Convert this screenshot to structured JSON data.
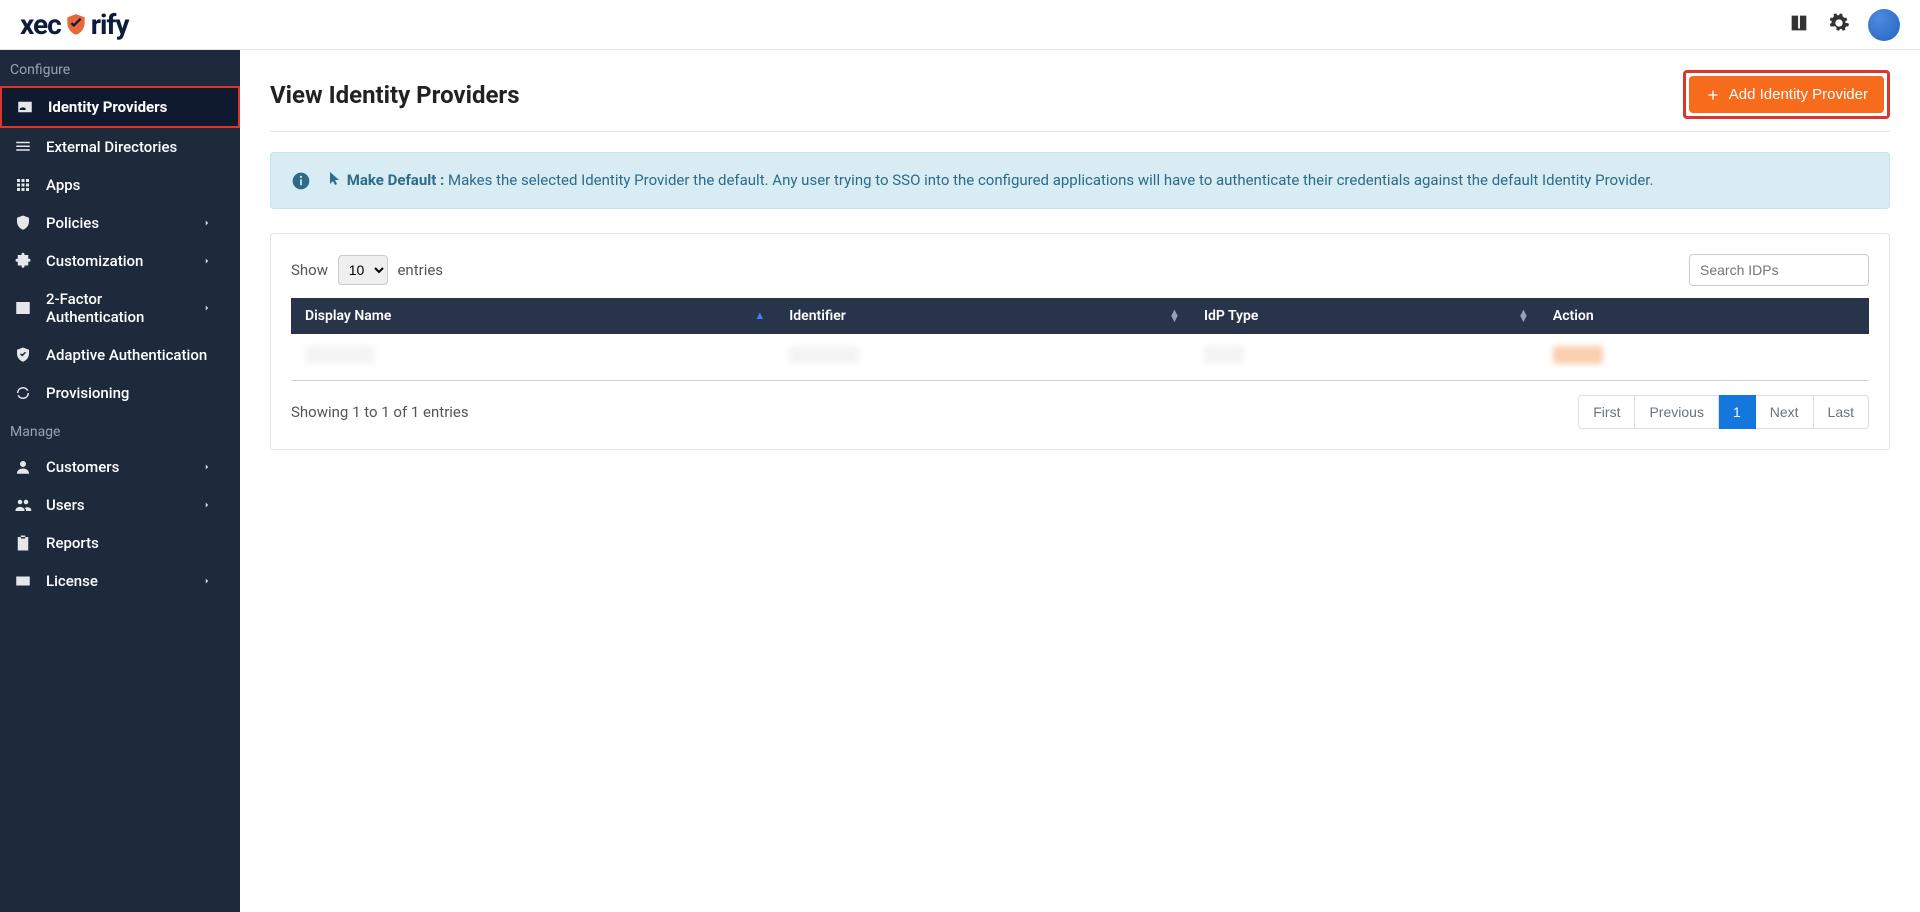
{
  "brand": {
    "pre": "xec",
    "post": "rify"
  },
  "sidebar": {
    "sections": [
      {
        "label": "Configure",
        "items": [
          {
            "label": "Identity Providers",
            "icon": "id-card-icon",
            "active": true,
            "highlighted": true,
            "chevron": false
          },
          {
            "label": "External Directories",
            "icon": "list-icon",
            "active": false,
            "highlighted": false,
            "chevron": false
          },
          {
            "label": "Apps",
            "icon": "grid-icon",
            "active": false,
            "highlighted": false,
            "chevron": false
          },
          {
            "label": "Policies",
            "icon": "shield-icon",
            "active": false,
            "highlighted": false,
            "chevron": true
          },
          {
            "label": "Customization",
            "icon": "puzzle-icon",
            "active": false,
            "highlighted": false,
            "chevron": true
          },
          {
            "label": "2-Factor Authentication",
            "icon": "keypad-icon",
            "active": false,
            "highlighted": false,
            "chevron": true
          },
          {
            "label": "Adaptive Authentication",
            "icon": "shield-check-icon",
            "active": false,
            "highlighted": false,
            "chevron": false
          },
          {
            "label": "Provisioning",
            "icon": "sync-icon",
            "active": false,
            "highlighted": false,
            "chevron": false
          }
        ]
      },
      {
        "label": "Manage",
        "items": [
          {
            "label": "Customers",
            "icon": "person-icon",
            "active": false,
            "highlighted": false,
            "chevron": true
          },
          {
            "label": "Users",
            "icon": "people-icon",
            "active": false,
            "highlighted": false,
            "chevron": true
          },
          {
            "label": "Reports",
            "icon": "clipboard-icon",
            "active": false,
            "highlighted": false,
            "chevron": false
          },
          {
            "label": "License",
            "icon": "card-icon",
            "active": false,
            "highlighted": false,
            "chevron": true
          }
        ]
      }
    ]
  },
  "page": {
    "title": "View Identity Providers",
    "add_button": "Add Identity Provider"
  },
  "info": {
    "lead": "Make Default :",
    "body": "Makes the selected Identity Provider the default. Any user trying to SSO into the configured applications will have to authenticate their credentials against the default Identity Provider."
  },
  "table": {
    "show_label_pre": "Show",
    "show_label_post": "entries",
    "show_value": "10",
    "search_placeholder": "Search IDPs",
    "columns": [
      "Display Name",
      "Identifier",
      "IdP Type",
      "Action"
    ],
    "rows": [
      {
        "display_name": "(redacted)",
        "identifier": "(redacted)",
        "idp_type": "(redacted)",
        "action": "(redacted)"
      }
    ],
    "footer_info": "Showing 1 to 1 of 1 entries",
    "pager": {
      "first": "First",
      "previous": "Previous",
      "page": "1",
      "next": "Next",
      "last": "Last"
    }
  }
}
